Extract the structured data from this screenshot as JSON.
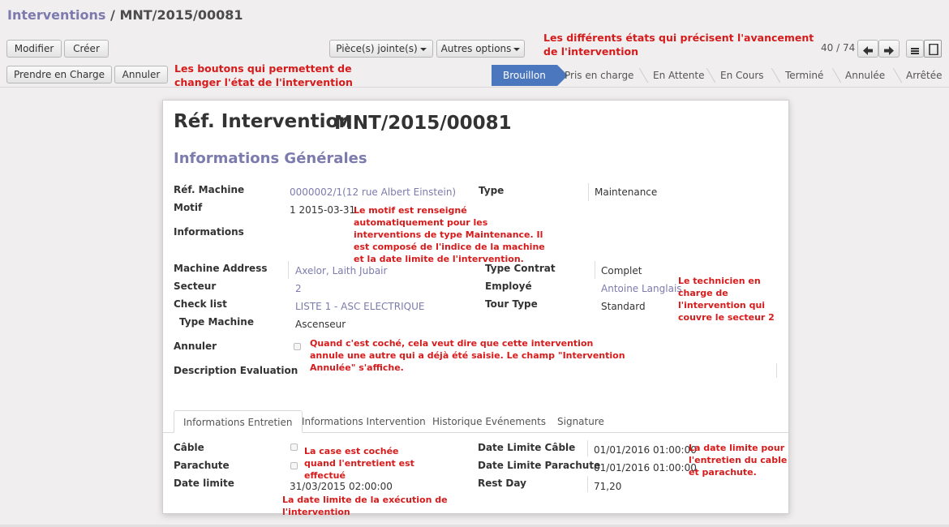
{
  "breadcrumb": {
    "parent": "Interventions",
    "separator": " / ",
    "current": "MNT/2015/00081"
  },
  "toolbar": {
    "edit_label": "Modifier",
    "create_label": "Créer",
    "attachments_label": "Pièce(s) jointe(s)",
    "more_label": "Autres options"
  },
  "pager": {
    "value": "40 / 74"
  },
  "actions": {
    "take_label": "Prendre en Charge",
    "cancel_label": "Annuler"
  },
  "stages": [
    "Brouillon",
    "Pris en charge",
    "En Attente",
    "En Cours",
    "Terminé",
    "Annulée",
    "Arrêtée"
  ],
  "active_stage": "Brouillon",
  "annotations": {
    "states": "Les différents états qui précisent l'avancement de l'intervention",
    "buttons": "Les boutons qui permettent de changer l'état de l'intervention",
    "motif": "Le motif est renseigné automatiquement pour les interventions de type Maintenance. Il est composé de l'indice de la machine et la date limite de l'intervention.",
    "technician": "Le technicien en charge de l'intervention qui couvre le secteur 2",
    "cancel": "Quand c'est coché, cela veut dire que cette intervention annule une autre qui a déjà été saisie. Le champ \"Intervention Annulée\" s'affiche.",
    "checkbox": "La case est cochée quand l'entretient est effectué",
    "limit_dates": "La date limite pour l'entretien du cable et parachute.",
    "exec_date": "La date limite de la exécution de l'intervention"
  },
  "form": {
    "title_label": "Réf. Intervention",
    "reference": "MNT/2015/00081",
    "section_title": "Informations Générales",
    "fields": {
      "ref_machine": {
        "label": "Réf. Machine",
        "value": "0000002/1(12 rue Albert Einstein)"
      },
      "type": {
        "label": "Type",
        "value": "Maintenance"
      },
      "motif": {
        "label": "Motif",
        "value": "1 2015-03-31"
      },
      "informations": {
        "label": "Informations"
      },
      "machine_address": {
        "label": "Machine Address",
        "value": "Axelor, Laith Jubair"
      },
      "secteur": {
        "label": "Secteur",
        "value": "2"
      },
      "check_list": {
        "label": "Check list",
        "value": "LISTE 1 - ASC ELECTRIQUE"
      },
      "type_machine": {
        "label": "Type Machine",
        "value": "Ascenseur"
      },
      "type_contrat": {
        "label": "Type Contrat",
        "value": "Complet"
      },
      "employe": {
        "label": "Employé",
        "value": "Antoine Langlais"
      },
      "tour_type": {
        "label": "Tour Type",
        "value": "Standard"
      },
      "annuler": {
        "label": "Annuler",
        "checked": false
      },
      "description": {
        "label": "Description Evaluation"
      }
    },
    "tabs": [
      "Informations Entretien",
      "Informations Intervention",
      "Historique Evénements",
      "Signature"
    ],
    "maintenance": {
      "cable": {
        "label": "Câble",
        "checked": false
      },
      "parachute": {
        "label": "Parachute",
        "checked": false
      },
      "date_limite": {
        "label": "Date limite",
        "value": "31/03/2015 02:00:00"
      },
      "date_cable": {
        "label": "Date Limite Câble",
        "value": "01/01/2016 01:00:00"
      },
      "date_parachute": {
        "label": "Date Limite Parachute",
        "value": "01/01/2016 01:00:00"
      },
      "rest_day": {
        "label": "Rest Day",
        "value": "71,20"
      }
    }
  }
}
